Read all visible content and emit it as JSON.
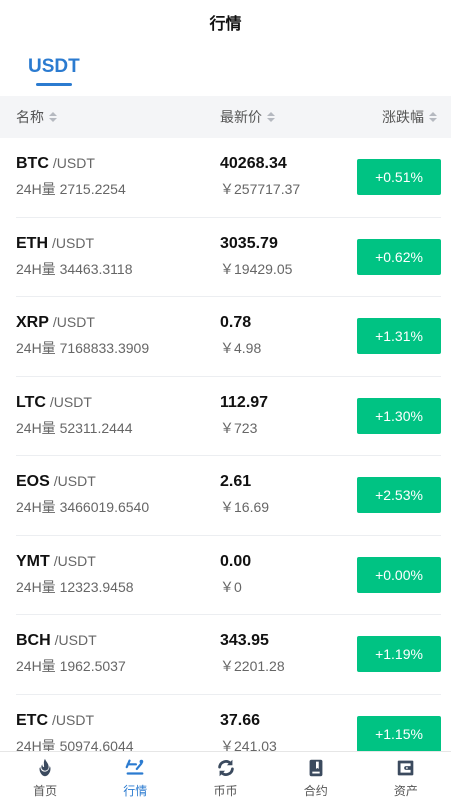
{
  "header": {
    "title": "行情"
  },
  "tabs": [
    {
      "label": "USDT"
    }
  ],
  "columns": {
    "name": "名称",
    "price": "最新价",
    "change": "涨跌幅"
  },
  "rows": [
    {
      "symbol": "BTC",
      "pair": "/USDT",
      "volume": "24H量 2715.2254",
      "price": "40268.34",
      "cny": "￥257717.37",
      "change": "+0.51%"
    },
    {
      "symbol": "ETH",
      "pair": "/USDT",
      "volume": "24H量 34463.3118",
      "price": "3035.79",
      "cny": "￥19429.05",
      "change": "+0.62%"
    },
    {
      "symbol": "XRP",
      "pair": "/USDT",
      "volume": "24H量 7168833.3909",
      "price": "0.78",
      "cny": "￥4.98",
      "change": "+1.31%"
    },
    {
      "symbol": "LTC",
      "pair": "/USDT",
      "volume": "24H量 52311.2444",
      "price": "112.97",
      "cny": "￥723",
      "change": "+1.30%"
    },
    {
      "symbol": "EOS",
      "pair": "/USDT",
      "volume": "24H量 3466019.6540",
      "price": "2.61",
      "cny": "￥16.69",
      "change": "+2.53%"
    },
    {
      "symbol": "YMT",
      "pair": "/USDT",
      "volume": "24H量 12323.9458",
      "price": "0.00",
      "cny": "￥0",
      "change": "+0.00%"
    },
    {
      "symbol": "BCH",
      "pair": "/USDT",
      "volume": "24H量 1962.5037",
      "price": "343.95",
      "cny": "￥2201.28",
      "change": "+1.19%"
    },
    {
      "symbol": "ETC",
      "pair": "/USDT",
      "volume": "24H量 50974.6044",
      "price": "37.66",
      "cny": "￥241.03",
      "change": "+1.15%"
    }
  ],
  "nav": [
    {
      "label": "首页",
      "icon": "flame-icon"
    },
    {
      "label": "行情",
      "icon": "market-icon"
    },
    {
      "label": "币币",
      "icon": "exchange-icon"
    },
    {
      "label": "合约",
      "icon": "contract-icon"
    },
    {
      "label": "资产",
      "icon": "wallet-icon"
    }
  ],
  "colors": {
    "accent": "#2b7bd0",
    "up": "#00c383",
    "nav_icon": "#3b4a5e"
  }
}
